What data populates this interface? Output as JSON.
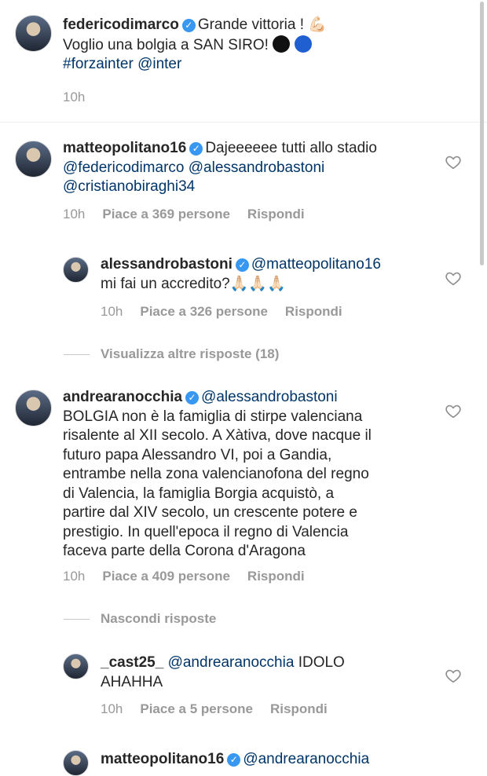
{
  "caption": {
    "username": "federicodimarco",
    "text_1": "Grande vittoria ! 💪🏻",
    "text_2": "Voglio una bolgia a SAN SIRO! ",
    "hashtag": "#forzainter",
    "mention": "@inter",
    "time": "10h"
  },
  "comments": [
    {
      "username": "matteopolitano16",
      "text_1": "Dajeeeeee tutti allo stadio",
      "mention_1": "@federicodimarco",
      "mention_2": "@alessandrobastoni",
      "mention_3": "@cristianobiraghi34",
      "time": "10h",
      "likes": "Piace a 369 persone",
      "reply": "Rispondi",
      "replies": [
        {
          "username": "alessandrobastoni",
          "mention": "@matteopolitano16",
          "text": "mi fai un accredito?🙏🏻🙏🏻🙏🏻",
          "time": "10h",
          "likes": "Piace a 326 persone",
          "reply": "Rispondi"
        }
      ],
      "toggle": "Visualizza altre risposte (18)"
    },
    {
      "username": "andrearanocchia",
      "mention": "@alessandrobastoni",
      "lines": [
        "BOLGIA non è la famiglia di stirpe valenciana",
        "risalente al XII secolo. A Xàtiva, dove nacque il",
        "futuro papa Alessandro VI, poi a Gandia,",
        "entrambe nella zona valencianofona del regno",
        "di Valencia, la famiglia Borgia acquistò, a",
        "partire dal XIV secolo, un crescente potere e",
        "prestigio. In quell'epoca il regno di Valencia",
        "faceva parte della Corona d'Aragona"
      ],
      "time": "10h",
      "likes": "Piace a 409 persone",
      "reply": "Rispondi",
      "toggle": "Nascondi risposte",
      "replies": [
        {
          "username": "_cast25_",
          "mention": "@andrearanocchia",
          "text_1": "IDOLO",
          "text_2": "AHAHHA",
          "time": "10h",
          "likes": "Piace a 5 persone",
          "reply": "Rispondi"
        },
        {
          "username": "matteopolitano16",
          "mention": "@andrearanocchia"
        }
      ]
    }
  ],
  "colors": {
    "verified": "#3897f0",
    "mention": "#003569",
    "meta": "#999999"
  }
}
